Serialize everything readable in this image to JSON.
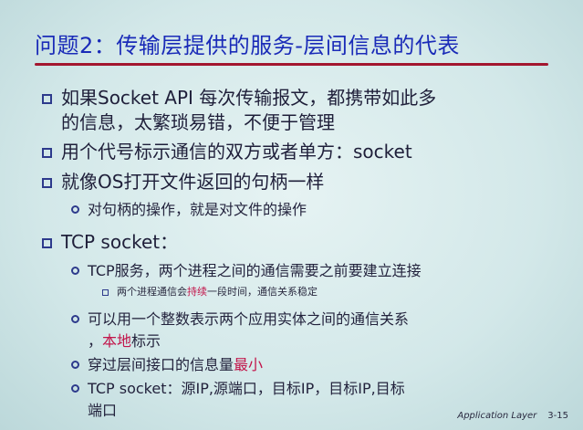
{
  "title": "问题2：传输层提供的服务-层间信息的代表",
  "bullets": {
    "b1_line1": "如果Socket API 每次传输报文，都携带如此多",
    "b1_line2": "的信息，太繁琐易错，不便于管理",
    "b2": "用个代号标示通信的双方或者单方：socket",
    "b3": "就像OS打开文件返回的句柄一样",
    "b3_sub": "对句柄的操作，就是对文件的操作",
    "b4": "TCP socket：",
    "b4_sub1": "TCP服务，两个进程之间的通信需要之前要建立连接",
    "b4_sub1_detail_a": "两个进程通信会",
    "b4_sub1_detail_red": "持续",
    "b4_sub1_detail_b": "一段时间，通信关系稳定",
    "b4_sub2_line1": "可以用一个整数表示两个应用实体之间的通信关系",
    "b4_sub2_line2_a": "，",
    "b4_sub2_line2_red": "本地",
    "b4_sub2_line2_b": "标示",
    "b4_sub3_a": "穿过层间接口的信息量",
    "b4_sub3_red": "最小",
    "b4_sub4_line1": "TCP socket：源IP,源端口，目标IP，目标IP,目标",
    "b4_sub4_line2": "端口"
  },
  "footer": {
    "label": "Application Layer",
    "page": "3-15"
  },
  "colors": {
    "title": "#1a2bb8",
    "rule": "#a3162f",
    "emphasis": "#c2144a",
    "bullet": "#2d3a8c"
  }
}
